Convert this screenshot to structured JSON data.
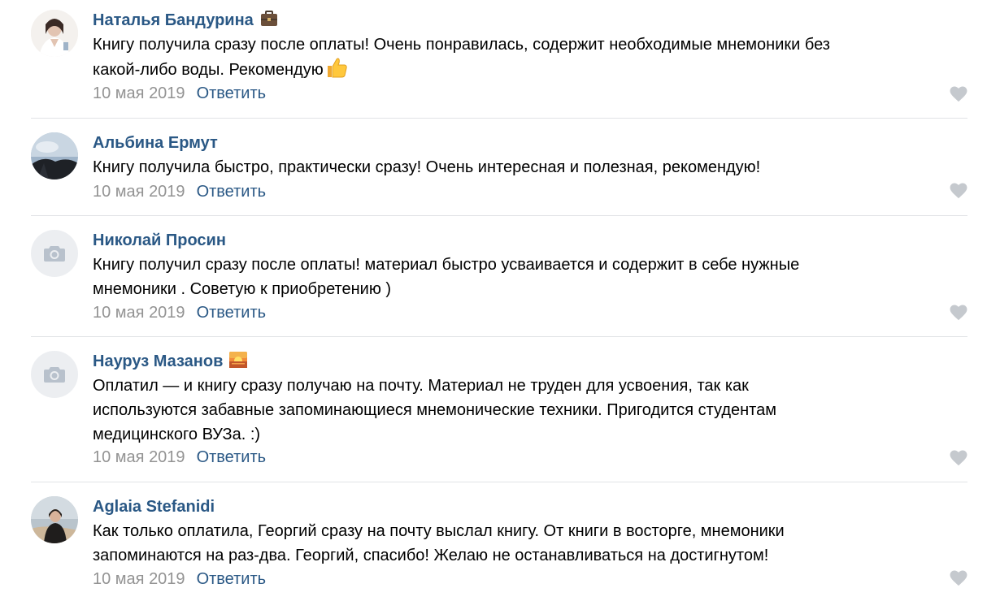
{
  "comments": [
    {
      "author": "Наталья Бандурина",
      "author_emoji": "briefcase-icon",
      "avatar": "photo-woman",
      "lines": [
        "Книгу получила сразу после оплаты! Очень понравилась, содержит необходимые мнемоники без",
        "какой-либо воды. Рекомендую"
      ],
      "trailing_emoji": "thumbs-up-icon",
      "date": "10 мая 2019",
      "reply_label": "Ответить"
    },
    {
      "author": "Альбина Ермут",
      "avatar": "photo-landscape",
      "lines": [
        "Книгу получила быстро, практически сразу! Очень интересная и полезная, рекомендую!"
      ],
      "date": "10 мая 2019",
      "reply_label": "Ответить"
    },
    {
      "author": "Николай Просин",
      "avatar": "camera-placeholder",
      "lines": [
        "Книгу получил сразу после оплаты! материал быстро усваивается и содержит в себе нужные",
        "мнемоники . Советую к приобретению )"
      ],
      "date": "10 мая 2019",
      "reply_label": "Ответить"
    },
    {
      "author": "Науруз Мазанов",
      "author_emoji": "sunset-icon",
      "avatar": "camera-placeholder",
      "lines": [
        "Оплатил — и книгу сразу получаю на почту. Материал не труден для усвоения, так как",
        "используются забавные запоминающиеся мнемонические техники. Пригодится студентам",
        "медицинского ВУЗа. :)"
      ],
      "date": "10 мая 2019",
      "reply_label": "Ответить"
    },
    {
      "author": "Aglaia Stefanidi",
      "avatar": "photo-person",
      "lines": [
        "Как только оплатила, Георгий сразу на почту выслал книгу. От книги в восторге, мнемоники",
        "запоминаются на раз-два. Георгий, спасибо! Желаю не останавливаться на достигнутом!"
      ],
      "date": "10 мая 2019",
      "reply_label": "Ответить"
    }
  ],
  "colors": {
    "link": "#2a5885",
    "muted": "#939393",
    "divider": "#e1e3e6",
    "like_icon": "#c5c9ce",
    "placeholder_bg": "#eceef1",
    "placeholder_icon": "#b8c1cc"
  }
}
